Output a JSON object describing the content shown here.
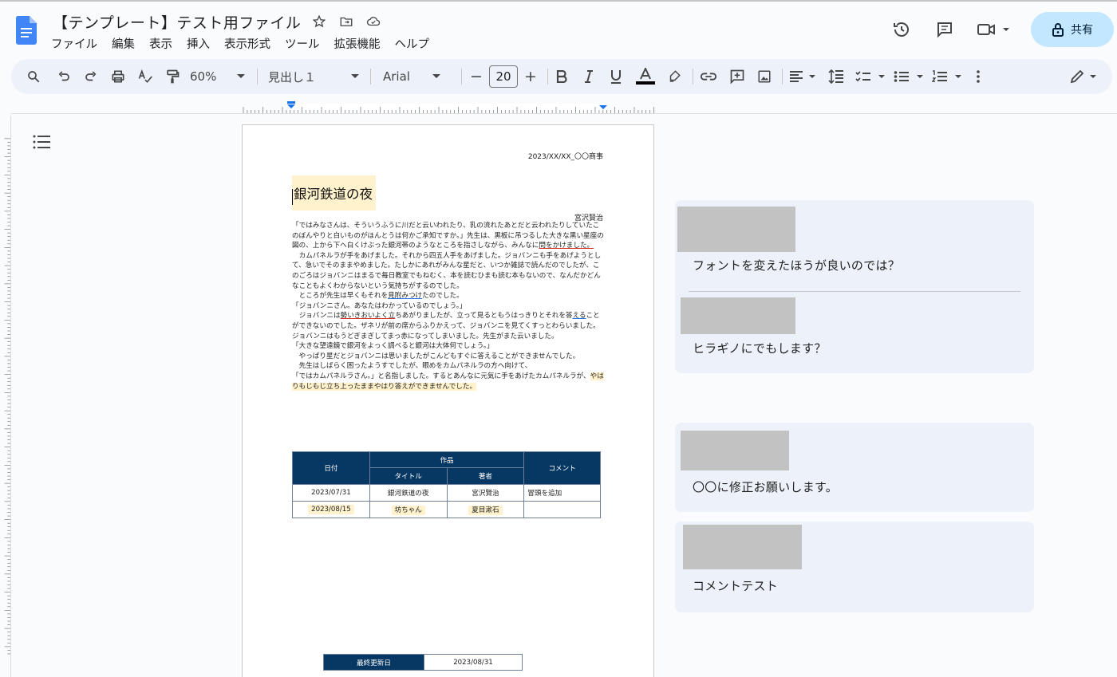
{
  "document": {
    "title": "【テンプレート】テスト用ファイル"
  },
  "menu": [
    "ファイル",
    "編集",
    "表示",
    "挿入",
    "表示形式",
    "ツール",
    "拡張機能",
    "ヘルプ"
  ],
  "header": {
    "share_label": "共有"
  },
  "toolbar": {
    "zoom": "60%",
    "style": "見出し１",
    "font": "Arial",
    "font_size": "20",
    "minus": "−",
    "plus": "+"
  },
  "page": {
    "date_line": "2023/XX/XX_〇〇商事",
    "heading": "銀河鉄道の夜",
    "author": "宮沢賢治",
    "paragraphs": [
      "「ではみなさんは、そういうふうに川だと云いわれたり、乳の流れたあとだと云われたりしていたこのぼんやりと白いものがほんとうは何かご承知ですか。」先生は、黒板に吊つるした大きな黒い星座の図の、上から下へ白くけぶった銀河帯のようなところを指さしながら、みんなに",
      "カムパネルラが手をあげました。それから四五人手をあげました。ジョバンニも手をあげようとして、急いでそのままやめました。たしかにあれがみんな星だと、いつか雑誌で読んだのでしたが、このごろはジョバンニはまるで毎日教室でもねむく、本を読むひまも読む本もないので、なんだかどんなこともよくわからないという気持ちがするのでした。",
      "「ジョバンニさん。あなたはわかっているのでしょう。」",
      "「大きな望遠鏡で銀河をよっく調べると銀河は大体何でしょう。」",
      "やっぱり星だとジョバンニは思いましたがこんどもすぐに答えることができませんでした。",
      "先生はしばらく困ったようすでしたが、眼めをカムパネルラの方へ向けて、"
    ],
    "p1_link": "問をかけました。",
    "p3_pre": "ところが先生は早くもそれを",
    "p3_link": "見附みつけ",
    "p3_post": "たのでした。",
    "p5_pre": "ジョバンニは",
    "p5_link": "勢いきおいよく立",
    "p5_post": "ちあがりましたが、立って見るともうはっきりとそれを答",
    "p5_link2": "える",
    "p5_post2": "ことができないのでした。ザネリが前の席からふりかえって、ジョバンニを見てくすっとわらいました。ジョバンニはもうどぎまぎしてまっ赤になってしまいました。先生がまた云いました。",
    "p9_pre": "「ではカムパネルラさん。」と名指しました。するとあんなに元気に手をあげたカムパネルラが、",
    "p9_hl": "やはりもじもじ立ち上ったままやはり答えができませんでした。",
    "table": {
      "col_date": "日付",
      "col_work": "作品",
      "col_title": "タイトル",
      "col_author": "著者",
      "col_comment": "コメント",
      "rows": [
        {
          "date": "2023/07/31",
          "title": "銀河鉄道の夜",
          "author": "宮沢賢治",
          "comment": "冒頭を追加"
        },
        {
          "date": "2023/08/15",
          "title": "坊ちゃん",
          "author": "夏目漱石",
          "comment": ""
        }
      ]
    },
    "footer": {
      "label": "最終更新日",
      "value": "2023/08/31"
    }
  },
  "comments": [
    {
      "text": "フォントを変えたほうが良いのでは？"
    },
    {
      "text": "ヒラギノにでもします？"
    },
    {
      "text": "〇〇に修正お願いします。"
    },
    {
      "text": "コメントテスト"
    }
  ]
}
